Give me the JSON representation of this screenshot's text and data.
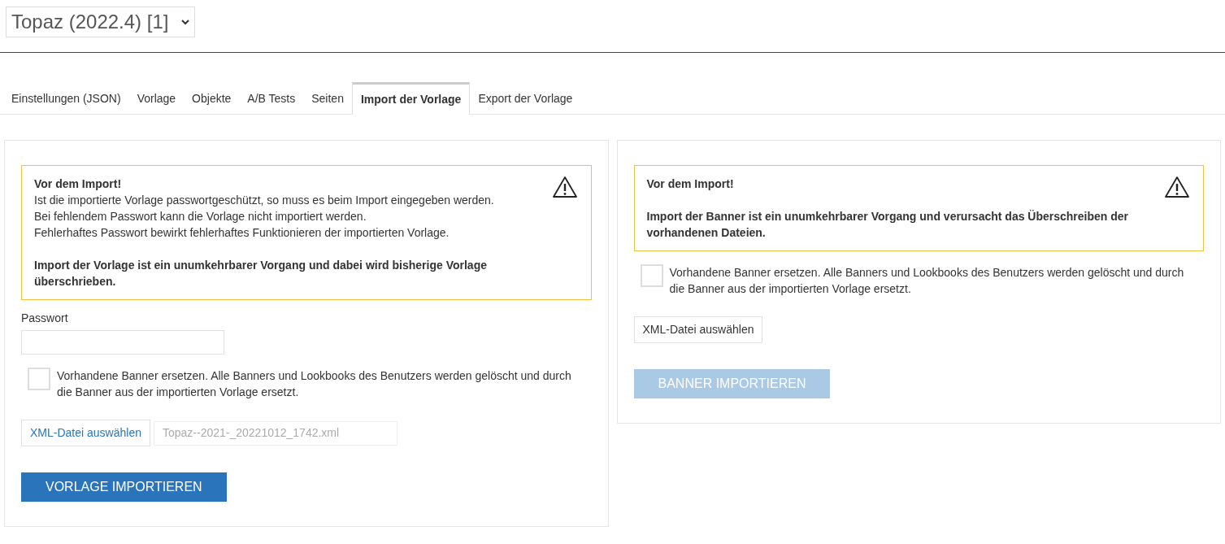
{
  "template_select": {
    "value": "Topaz (2022.4) [1]"
  },
  "tabs": [
    {
      "label": "Einstellungen (JSON)",
      "selected": false
    },
    {
      "label": "Vorlage",
      "selected": false
    },
    {
      "label": "Objekte",
      "selected": false
    },
    {
      "label": "A/B Tests",
      "selected": false
    },
    {
      "label": "Seiten",
      "selected": false
    },
    {
      "label": "Import der Vorlage",
      "selected": true
    },
    {
      "label": "Export der Vorlage",
      "selected": false
    }
  ],
  "panels": [
    {
      "warning": {
        "blocks": [
          [
            {
              "text": "Vor dem Import!",
              "bold": true
            },
            {
              "text": "Ist die importierte Vorlage passwortgeschützt, so muss es beim Import eingegeben werden.",
              "bold": false
            },
            {
              "text": "Bei fehlendem Passwort kann die Vorlage nicht importiert werden.",
              "bold": false
            },
            {
              "text": "Fehlerhaftes Passwort bewirkt fehlerhaftes Funktionieren der importierten Vorlage.",
              "bold": false
            }
          ],
          [
            {
              "text": "Import der Vorlage ist ein unumkehrbarer Vorgang und dabei wird bisherige Vorlage überschrieben.",
              "bold": true
            }
          ]
        ]
      },
      "password": {
        "label": "Passwort"
      },
      "checkbox": {
        "label": "Vorhandene Banner ersetzen. Alle Banners und Lookbooks des Benutzers werden gelöscht und durch die Banner aus der importierten Vorlage ersetzt.",
        "checked": false
      },
      "file_button": {
        "label": "XML-Datei auswählen",
        "highlighted": true
      },
      "file_name": "Topaz--2021-_20221012_1742.xml",
      "import_button": {
        "label": "VORLAGE IMPORTIEREN",
        "disabled": false
      }
    },
    {
      "warning": {
        "blocks": [
          [
            {
              "text": "Vor dem Import!",
              "bold": true
            }
          ],
          [
            {
              "text": "Import der Banner ist ein unumkehrbarer Vorgang und verursacht das Überschreiben der vorhandenen Dateien.",
              "bold": true
            }
          ]
        ]
      },
      "checkbox": {
        "label": "Vorhandene Banner ersetzen. Alle Banners und Lookbooks des Benutzers werden gelöscht und durch die Banner aus der importierten Vorlage ersetzt.",
        "checked": false
      },
      "file_button": {
        "label": "XML-Datei auswählen",
        "highlighted": false
      },
      "import_button": {
        "label": "BANNER IMPORTIEREN",
        "disabled": true
      }
    }
  ]
}
